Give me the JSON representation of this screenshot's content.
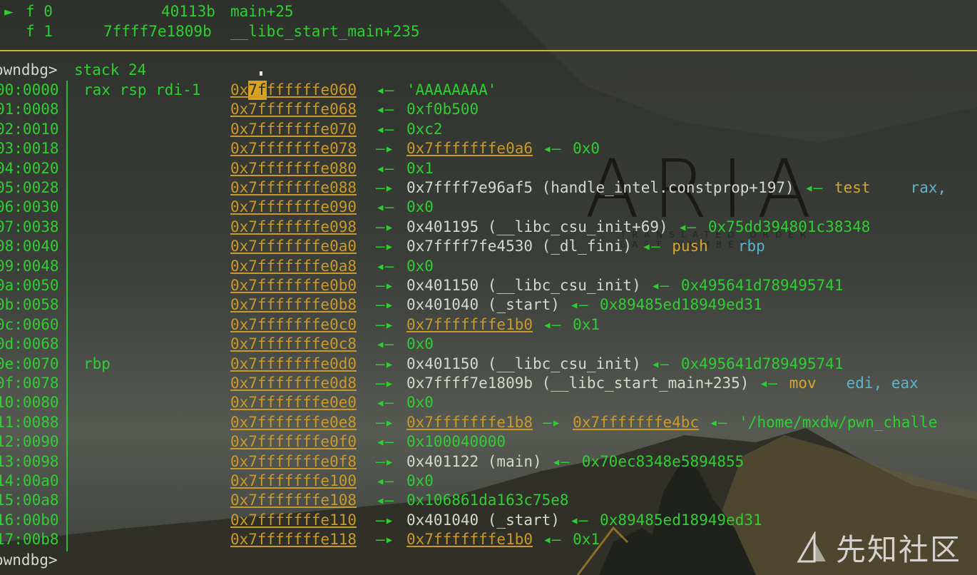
{
  "frames": [
    {
      "marker": "►",
      "id": "f 0",
      "addr": "40113b",
      "sym": "main+25"
    },
    {
      "marker": "",
      "id": "f 1",
      "addr": "7ffff7e1809b",
      "sym": "__libc_start_main+235"
    }
  ],
  "prompt": "owndbg>",
  "command": "stack 24",
  "rows": [
    {
      "off": "00:0000",
      "regs": "rax rsp rdi-1",
      "addr_hl": "7f",
      "addr": "0xfffffffe060",
      "arrow": "◂—",
      "rest": "'AAAAAAAA'"
    },
    {
      "off": "01:0008",
      "regs": "",
      "addr": "0x7fffffffe068",
      "arrow": "◂—",
      "rest": "0xf0b500"
    },
    {
      "off": "02:0010",
      "regs": "",
      "addr": "0x7fffffffe070",
      "arrow": "◂—",
      "rest": "0xc2"
    },
    {
      "off": "03:0018",
      "regs": "",
      "addr": "0x7fffffffe078",
      "arrow": "—▸",
      "link": "0x7fffffffe0a6",
      "arrow2": "◂—",
      "rest": "0x0"
    },
    {
      "off": "04:0020",
      "regs": "",
      "addr": "0x7fffffffe080",
      "arrow": "◂—",
      "rest": "0x1"
    },
    {
      "off": "05:0028",
      "regs": "",
      "addr": "0x7fffffffe088",
      "arrow": "—▸",
      "code": "0x7ffff7e96af5 (handle_intel.constprop+197)",
      "arrow2": "◂—",
      "ins": "test",
      "ops": "rax,"
    },
    {
      "off": "06:0030",
      "regs": "",
      "addr": "0x7fffffffe090",
      "arrow": "◂—",
      "rest": "0x0"
    },
    {
      "off": "07:0038",
      "regs": "",
      "addr": "0x7fffffffe098",
      "arrow": "—▸",
      "code": "0x401195 (__libc_csu_init+69)",
      "arrow2": "◂—",
      "rest": "0x75dd394801c38348"
    },
    {
      "off": "08:0040",
      "regs": "",
      "addr": "0x7fffffffe0a0",
      "arrow": "—▸",
      "code": "0x7ffff7fe4530 (_dl_fini)",
      "arrow2": "◂—",
      "ins": "push",
      "ops": "rbp"
    },
    {
      "off": "09:0048",
      "regs": "",
      "addr": "0x7fffffffe0a8",
      "arrow": "◂—",
      "rest": "0x0"
    },
    {
      "off": "0a:0050",
      "regs": "",
      "addr": "0x7fffffffe0b0",
      "arrow": "—▸",
      "code": "0x401150 (__libc_csu_init)",
      "arrow2": "◂—",
      "rest": "0x495641d789495741"
    },
    {
      "off": "0b:0058",
      "regs": "",
      "addr": "0x7fffffffe0b8",
      "arrow": "—▸",
      "code": "0x401040 (_start)",
      "arrow2": "◂—",
      "rest": "0x89485ed18949ed31"
    },
    {
      "off": "0c:0060",
      "regs": "",
      "addr": "0x7fffffffe0c0",
      "arrow": "—▸",
      "link": "0x7fffffffe1b0",
      "arrow2": "◂—",
      "rest": "0x1"
    },
    {
      "off": "0d:0068",
      "regs": "",
      "addr": "0x7fffffffe0c8",
      "arrow": "◂—",
      "rest": "0x0"
    },
    {
      "off": "0e:0070",
      "regs": "rbp",
      "addr": "0x7fffffffe0d0",
      "arrow": "—▸",
      "code": "0x401150 (__libc_csu_init)",
      "arrow2": "◂—",
      "rest": "0x495641d789495741"
    },
    {
      "off": "0f:0078",
      "regs": "",
      "addr": "0x7fffffffe0d8",
      "arrow": "—▸",
      "code": "0x7ffff7e1809b (__libc_start_main+235)",
      "arrow2": "◂—",
      "ins": "mov",
      "ops": "edi, eax"
    },
    {
      "off": "10:0080",
      "regs": "",
      "addr": "0x7fffffffe0e0",
      "arrow": "◂—",
      "rest": "0x0"
    },
    {
      "off": "11:0088",
      "regs": "",
      "addr": "0x7fffffffe0e8",
      "arrow": "—▸",
      "link": "0x7fffffffe1b8",
      "arrow2": "—▸",
      "link2": "0x7fffffffe4bc",
      "arrow3": "◂—",
      "rest": "'/home/mxdw/pwn_challe"
    },
    {
      "off": "12:0090",
      "regs": "",
      "addr": "0x7fffffffe0f0",
      "arrow": "◂—",
      "rest": "0x100040000"
    },
    {
      "off": "13:0098",
      "regs": "",
      "addr": "0x7fffffffe0f8",
      "arrow": "—▸",
      "code": "0x401122 (main)",
      "arrow2": "◂—",
      "rest": "0x70ec8348e5894855"
    },
    {
      "off": "14:00a0",
      "regs": "",
      "addr": "0x7fffffffe100",
      "arrow": "◂—",
      "rest": "0x0"
    },
    {
      "off": "15:00a8",
      "regs": "",
      "addr": "0x7fffffffe108",
      "arrow": "◂—",
      "rest": "0x106861da163c75e8"
    },
    {
      "off": "16:00b0",
      "regs": "",
      "addr": "0x7fffffffe110",
      "arrow": "—▸",
      "code": "0x401040 (_start)",
      "arrow2": "◂—",
      "rest": "0x89485ed18949ed31"
    },
    {
      "off": "17:00b8",
      "regs": "",
      "addr": "0x7fffffffe118",
      "arrow": "—▸",
      "link": "0x7fffffffe1b0",
      "arrow2": "◂—",
      "rest": "0x1"
    }
  ],
  "final_prompt": "owndbg>",
  "watermark": {
    "icon": "xianzhi-logo-icon",
    "text": "先知社区"
  },
  "aria_logo": {
    "title": "ARIA",
    "sub1": "TRANSLATED ORDER",
    "sub2": "LAST NUMBER"
  },
  "colors": {
    "green": "#2fce32",
    "yellow": "#d6a72a",
    "cyan": "#5ab5cf",
    "text": "#d4d8cf",
    "separator": "#c9b62a"
  }
}
